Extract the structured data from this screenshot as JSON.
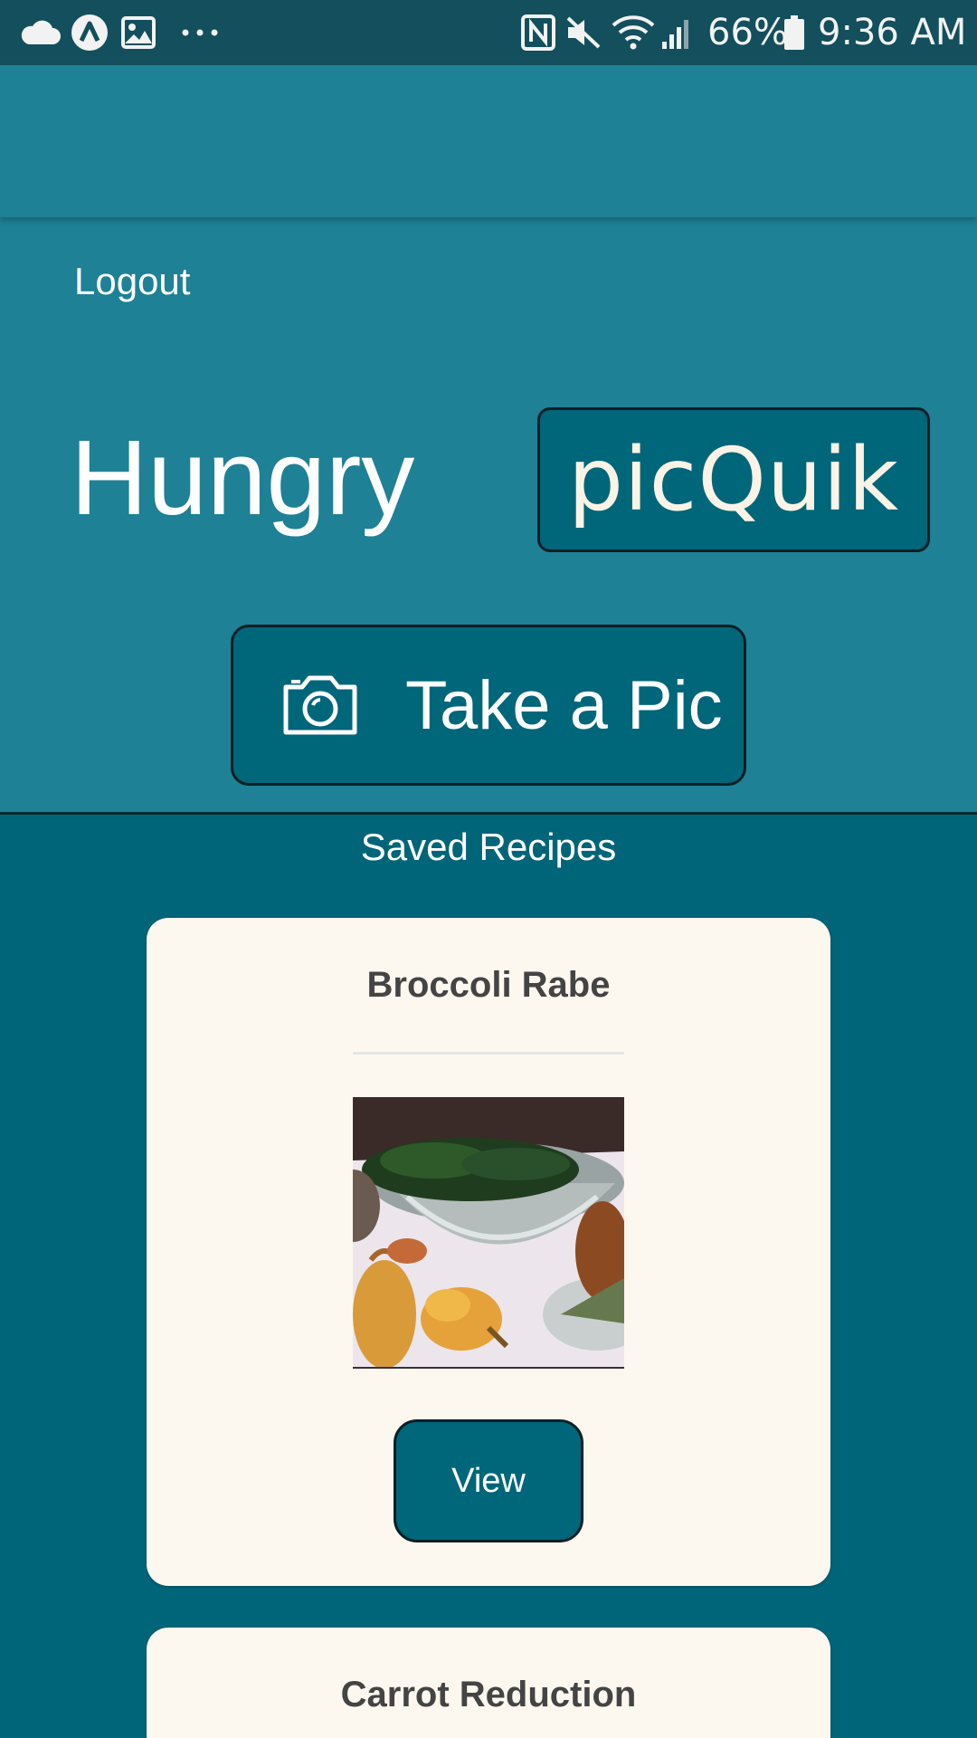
{
  "status_bar": {
    "icons_left": [
      "cloud-icon",
      "arrow-circle-icon",
      "image-icon",
      "more-dots-icon"
    ],
    "icons_right": [
      "nfc-icon",
      "mute-icon",
      "wifi-icon",
      "signal-icon",
      "battery-icon"
    ],
    "battery": "66%",
    "time": "9:36 AM"
  },
  "hero": {
    "logout_label": "Logout",
    "heading": "Hungry",
    "logo_text": "picQuik",
    "take_pic_label": "Take a Pic",
    "take_pic_icon": "camera-icon"
  },
  "saved": {
    "title": "Saved Recipes",
    "recipes": [
      {
        "name": "Broccoli Rabe",
        "button_label": "View"
      },
      {
        "name": "Carrot Reduction"
      }
    ]
  },
  "colors": {
    "status_bar": "#134f5c",
    "app_bar": "#1e8196",
    "page_background": "#016579",
    "button": "#00667a",
    "card": "#fdf8ef",
    "logo_text": "#fbf4e6"
  }
}
